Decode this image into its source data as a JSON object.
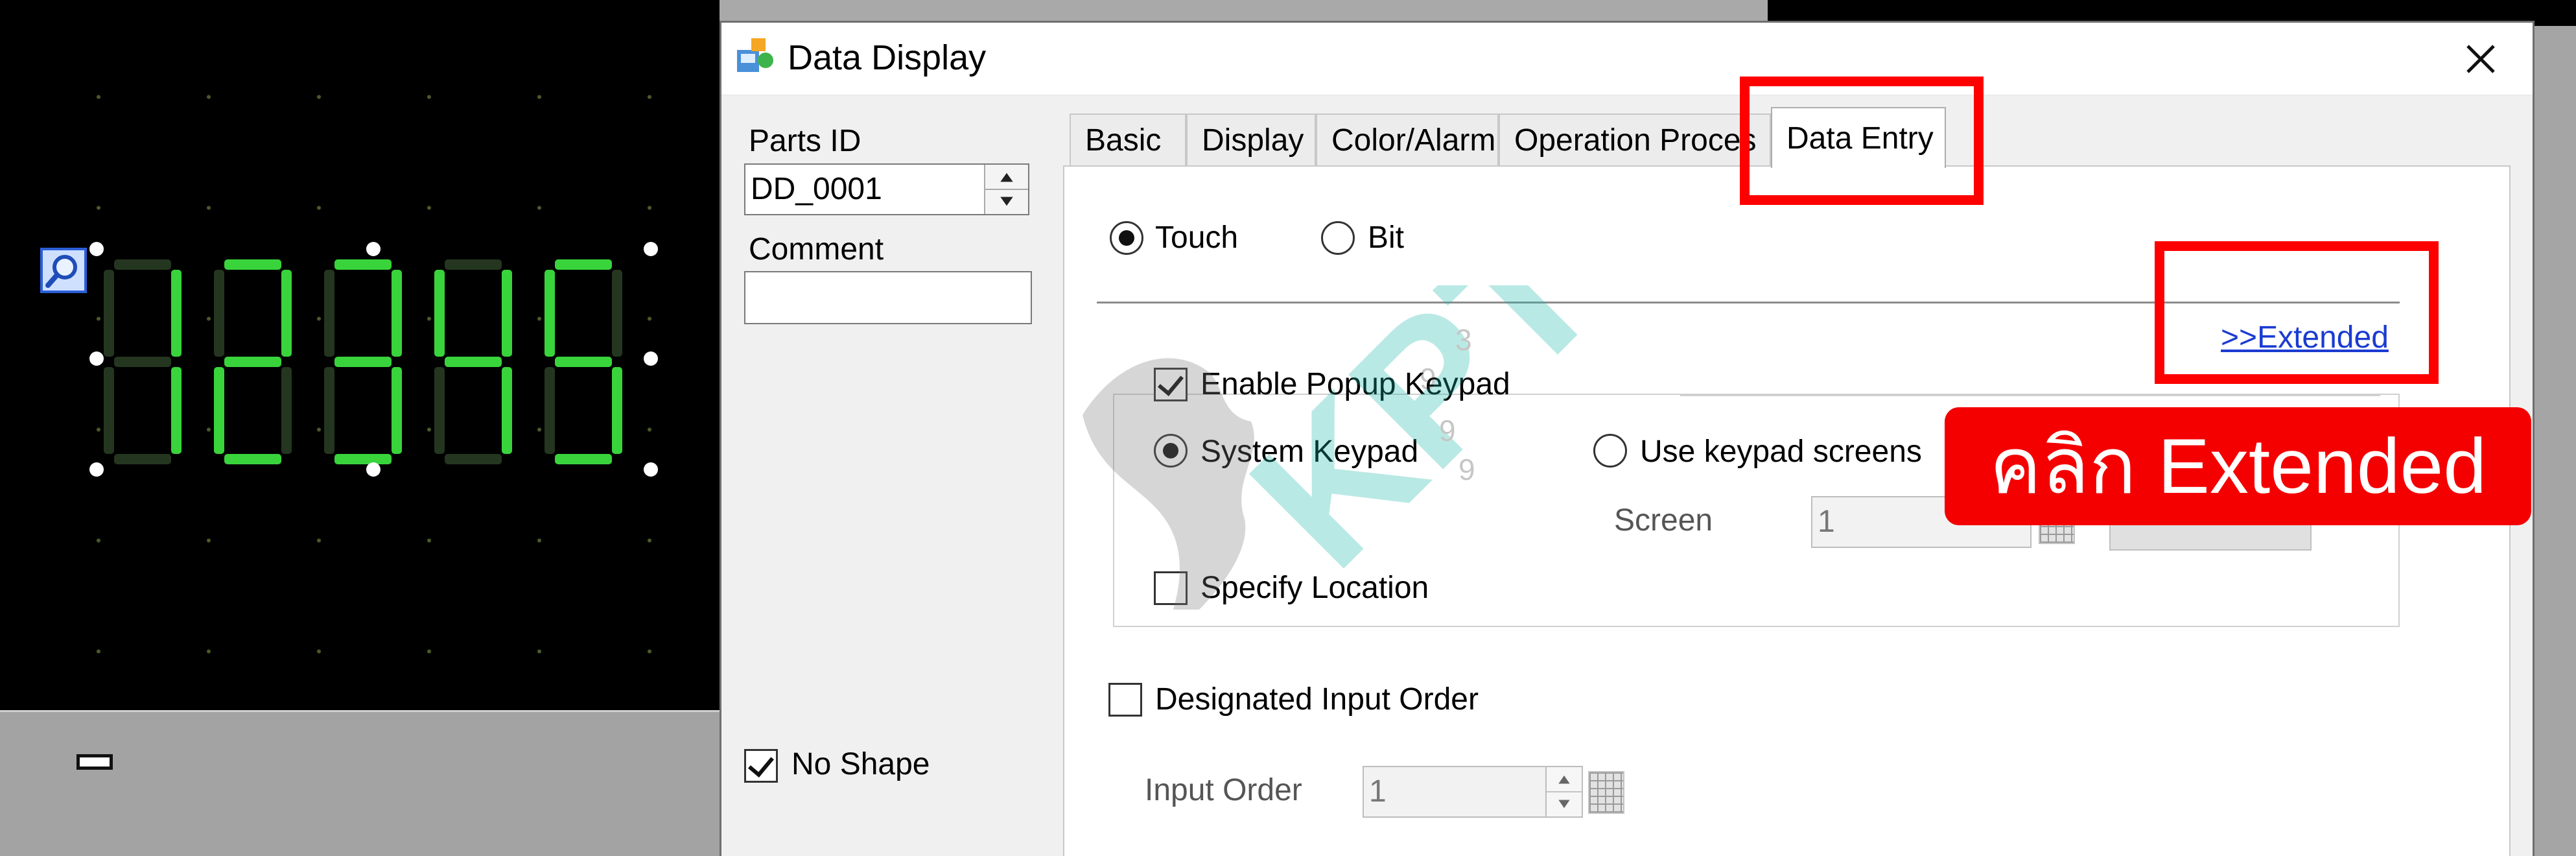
{
  "editor": {
    "seven_segment_value": "12345",
    "segment_color": "#39d43c",
    "segment_dim_color": "#24361f"
  },
  "dialog": {
    "title": "Data Display",
    "close_icon": "close-icon",
    "parts_id_label": "Parts ID",
    "parts_id_value": "DD_0001",
    "comment_label": "Comment",
    "comment_value": "",
    "no_shape_label": "No Shape",
    "no_shape_checked": true,
    "tabs": [
      {
        "label": "Basic",
        "active": false
      },
      {
        "label": "Display",
        "active": false
      },
      {
        "label": "Color/Alarm",
        "active": false
      },
      {
        "label": "Operation Proces",
        "active": false
      },
      {
        "label": "Data Entry",
        "active": true
      }
    ],
    "data_entry": {
      "touch_label": "Touch",
      "touch_selected": true,
      "bit_label": "Bit",
      "bit_selected": false,
      "extended_link": ">>Extended",
      "enable_popup_keypad_label": "Enable Popup Keypad",
      "enable_popup_keypad_checked": true,
      "system_keypad_label": "System Keypad",
      "system_keypad_selected": true,
      "use_keypad_screens_label": "Use keypad screens",
      "use_keypad_screens_selected": false,
      "screen_label": "Screen",
      "screen_value": "1",
      "specify_location_label": "Specify Location",
      "specify_location_checked": false,
      "designated_input_order_label": "Designated Input Order",
      "designated_input_order_checked": false,
      "input_order_label": "Input Order",
      "input_order_value": "1"
    }
  },
  "annotation": {
    "banner_text": "คลิก Extended",
    "highlight_color": "#ff0000"
  },
  "watermark": {
    "text": "KPT",
    "digits": [
      "9",
      "9",
      "3",
      "9"
    ]
  }
}
